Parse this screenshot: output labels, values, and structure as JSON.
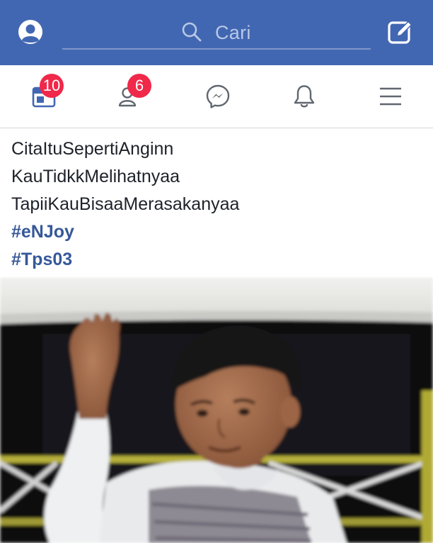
{
  "search": {
    "placeholder": "Cari"
  },
  "nav": {
    "items": [
      {
        "name": "news-feed",
        "icon": "news-feed-icon",
        "badge": "10"
      },
      {
        "name": "friend-requests",
        "icon": "friend-requests-icon",
        "badge": "6"
      },
      {
        "name": "messenger",
        "icon": "messenger-icon",
        "badge": null
      },
      {
        "name": "notifications",
        "icon": "bell-icon",
        "badge": null
      },
      {
        "name": "menu",
        "icon": "hamburger-menu-icon",
        "badge": null
      }
    ]
  },
  "post": {
    "lines": [
      "CitaItuSepertiAnginn",
      "KauTidkkMelihatnyaa",
      "TapiiKauBisaaMerasakanyaa"
    ],
    "hashtags": [
      "#eNJoy",
      "#Tps03"
    ]
  },
  "colors": {
    "brand": "#4267b2",
    "badge": "#f02849",
    "hashtag": "#365899",
    "text": "#1d2129"
  }
}
